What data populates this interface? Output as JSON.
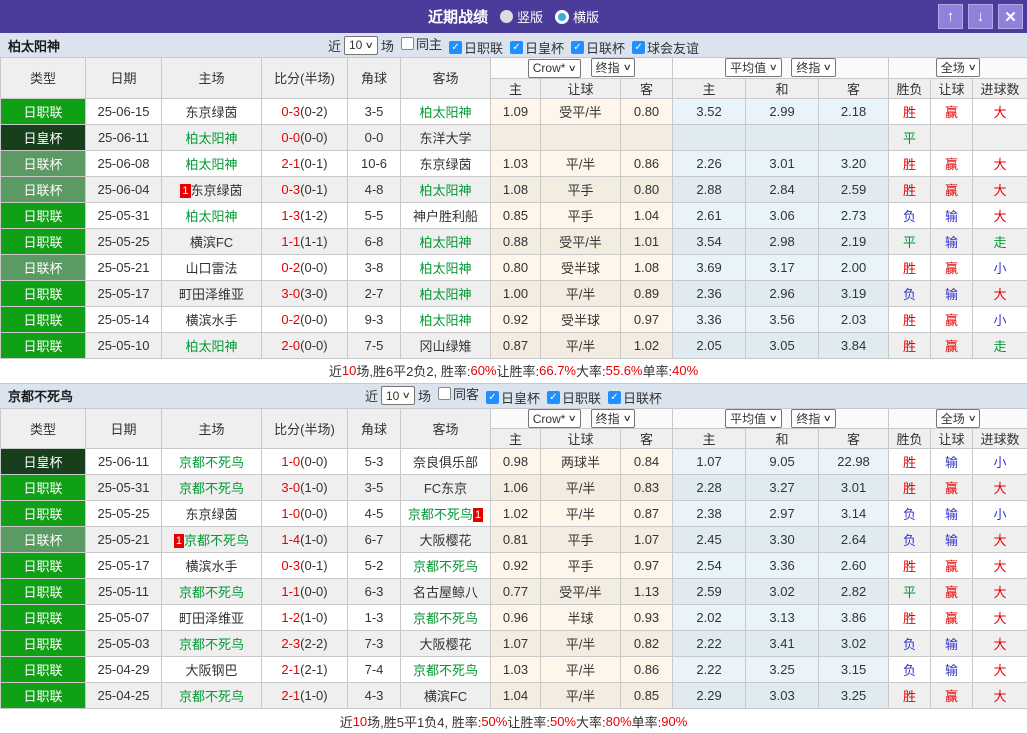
{
  "titlebar": {
    "title": "近期战绩",
    "options": [
      {
        "label": "竖版",
        "selected": false
      },
      {
        "label": "横版",
        "selected": true
      }
    ],
    "icons": {
      "up": "↑",
      "down": "↓",
      "close": "✕"
    }
  },
  "colors": {
    "accent_purple": "#4B3C9C",
    "league_jleague_green": "#0FA015",
    "league_emperor_cup_dark": "#173F1C",
    "league_league_cup_sage": "#5C9A64",
    "self_team_green": "#009933",
    "score_red": "#E60000",
    "result_blue": "#3333CC",
    "checkbox_blue": "#1E90FF"
  },
  "columns": {
    "type": "类型",
    "date": "日期",
    "home": "主场",
    "score": "比分(半场)",
    "corner": "角球",
    "away": "客场",
    "dd_crow": "Crow*",
    "dd_final1": "终指",
    "dd_avg": "平均值",
    "dd_final2": "终指",
    "dd_full": "全场",
    "g1_home": "主",
    "g1_handicap": "让球",
    "g1_away": "客",
    "g2_home": "主",
    "g2_draw": "和",
    "g2_away": "客",
    "res_wl": "胜负",
    "res_handicap": "让球",
    "res_goals": "进球数"
  },
  "sections": [
    {
      "team": "柏太阳神",
      "filter": {
        "near": "近",
        "count": "10",
        "games": "场",
        "checkboxes": [
          {
            "label": "同主",
            "checked": false
          },
          {
            "label": "日职联",
            "checked": true
          },
          {
            "label": "日皇杯",
            "checked": true
          },
          {
            "label": "日联杯",
            "checked": true
          },
          {
            "label": "球会友谊",
            "checked": true
          }
        ]
      },
      "rows": [
        {
          "type": "日职联",
          "tc": "green",
          "date": "25-06-15",
          "home": "东京绿茵",
          "hself": false,
          "hb": "",
          "hbp": "",
          "ft": "0-3",
          "ht": "(0-2)",
          "corner": "3-5",
          "away": "柏太阳神",
          "aself": true,
          "ab": "",
          "abp": "",
          "odds": [
            "1.09",
            "受平/半",
            "0.80",
            "3.52",
            "2.99",
            "2.18"
          ],
          "res": [
            [
              "胜",
              "r"
            ],
            [
              "赢",
              "r"
            ],
            [
              "大",
              "r"
            ]
          ]
        },
        {
          "type": "日皇杯",
          "tc": "dark",
          "date": "25-06-11",
          "home": "柏太阳神",
          "hself": true,
          "hb": "",
          "hbp": "",
          "ft": "0-0",
          "ht": "(0-0)",
          "corner": "0-0",
          "away": "东洋大学",
          "aself": false,
          "ab": "",
          "abp": "",
          "odds": [
            "",
            "",
            "",
            "",
            "",
            ""
          ],
          "res": [
            [
              "平",
              "g"
            ],
            [
              "",
              ""
            ],
            [
              "",
              ""
            ]
          ]
        },
        {
          "type": "日联杯",
          "tc": "sage",
          "date": "25-06-08",
          "home": "柏太阳神",
          "hself": true,
          "hb": "",
          "hbp": "",
          "ft": "2-1",
          "ht": "(0-1)",
          "corner": "10-6",
          "away": "东京绿茵",
          "aself": false,
          "ab": "",
          "abp": "",
          "odds": [
            "1.03",
            "平/半",
            "0.86",
            "2.26",
            "3.01",
            "3.20"
          ],
          "res": [
            [
              "胜",
              "r"
            ],
            [
              "赢",
              "r"
            ],
            [
              "大",
              "r"
            ]
          ]
        },
        {
          "type": "日联杯",
          "tc": "sage",
          "date": "25-06-04",
          "home": "东京绿茵",
          "hself": false,
          "hb": "1",
          "hbp": "before",
          "ft": "0-3",
          "ht": "(0-1)",
          "corner": "4-8",
          "away": "柏太阳神",
          "aself": true,
          "ab": "",
          "abp": "",
          "odds": [
            "1.08",
            "平手",
            "0.80",
            "2.88",
            "2.84",
            "2.59"
          ],
          "res": [
            [
              "胜",
              "r"
            ],
            [
              "赢",
              "r"
            ],
            [
              "大",
              "r"
            ]
          ]
        },
        {
          "type": "日职联",
          "tc": "green",
          "date": "25-05-31",
          "home": "柏太阳神",
          "hself": true,
          "hb": "",
          "hbp": "",
          "ft": "1-3",
          "ht": "(1-2)",
          "corner": "5-5",
          "away": "神户胜利船",
          "aself": false,
          "ab": "",
          "abp": "",
          "odds": [
            "0.85",
            "平手",
            "1.04",
            "2.61",
            "3.06",
            "2.73"
          ],
          "res": [
            [
              "负",
              "b"
            ],
            [
              "输",
              "b"
            ],
            [
              "大",
              "r"
            ]
          ]
        },
        {
          "type": "日职联",
          "tc": "green",
          "date": "25-05-25",
          "home": "横滨FC",
          "hself": false,
          "hb": "",
          "hbp": "",
          "ft": "1-1",
          "ht": "(1-1)",
          "corner": "6-8",
          "away": "柏太阳神",
          "aself": true,
          "ab": "",
          "abp": "",
          "odds": [
            "0.88",
            "受平/半",
            "1.01",
            "3.54",
            "2.98",
            "2.19"
          ],
          "res": [
            [
              "平",
              "g"
            ],
            [
              "输",
              "b"
            ],
            [
              "走",
              "g"
            ]
          ]
        },
        {
          "type": "日联杯",
          "tc": "sage",
          "date": "25-05-21",
          "home": "山口雷法",
          "hself": false,
          "hb": "",
          "hbp": "",
          "ft": "0-2",
          "ht": "(0-0)",
          "corner": "3-8",
          "away": "柏太阳神",
          "aself": true,
          "ab": "",
          "abp": "",
          "odds": [
            "0.80",
            "受半球",
            "1.08",
            "3.69",
            "3.17",
            "2.00"
          ],
          "res": [
            [
              "胜",
              "r"
            ],
            [
              "赢",
              "r"
            ],
            [
              "小",
              "b"
            ]
          ]
        },
        {
          "type": "日职联",
          "tc": "green",
          "date": "25-05-17",
          "home": "町田泽维亚",
          "hself": false,
          "hb": "",
          "hbp": "",
          "ft": "3-0",
          "ht": "(3-0)",
          "corner": "2-7",
          "away": "柏太阳神",
          "aself": true,
          "ab": "",
          "abp": "",
          "odds": [
            "1.00",
            "平/半",
            "0.89",
            "2.36",
            "2.96",
            "3.19"
          ],
          "res": [
            [
              "负",
              "b"
            ],
            [
              "输",
              "b"
            ],
            [
              "大",
              "r"
            ]
          ]
        },
        {
          "type": "日职联",
          "tc": "green",
          "date": "25-05-14",
          "home": "横滨水手",
          "hself": false,
          "hb": "",
          "hbp": "",
          "ft": "0-2",
          "ht": "(0-0)",
          "corner": "9-3",
          "away": "柏太阳神",
          "aself": true,
          "ab": "",
          "abp": "",
          "odds": [
            "0.92",
            "受半球",
            "0.97",
            "3.36",
            "3.56",
            "2.03"
          ],
          "res": [
            [
              "胜",
              "r"
            ],
            [
              "赢",
              "r"
            ],
            [
              "小",
              "b"
            ]
          ]
        },
        {
          "type": "日职联",
          "tc": "green",
          "date": "25-05-10",
          "home": "柏太阳神",
          "hself": true,
          "hb": "",
          "hbp": "",
          "ft": "2-0",
          "ht": "(0-0)",
          "corner": "7-5",
          "away": "冈山绿雉",
          "aself": false,
          "ab": "",
          "abp": "",
          "odds": [
            "0.87",
            "平/半",
            "1.02",
            "2.05",
            "3.05",
            "3.84"
          ],
          "res": [
            [
              "胜",
              "r"
            ],
            [
              "赢",
              "r"
            ],
            [
              "走",
              "g"
            ]
          ]
        }
      ],
      "summary": [
        [
          "近",
          "k"
        ],
        [
          "10",
          "r"
        ],
        [
          "场,胜6平2负2, 胜率:",
          "k"
        ],
        [
          "60%",
          "r"
        ],
        [
          " 让胜率:",
          "k"
        ],
        [
          "66.7%",
          "r"
        ],
        [
          " 大率:",
          "k"
        ],
        [
          "55.6%",
          "r"
        ],
        [
          " 单率:",
          "k"
        ],
        [
          "40%",
          "r"
        ]
      ]
    },
    {
      "team": "京都不死鸟",
      "filter": {
        "near": "近",
        "count": "10",
        "games": "场",
        "checkboxes": [
          {
            "label": "同客",
            "checked": false
          },
          {
            "label": "日皇杯",
            "checked": true
          },
          {
            "label": "日职联",
            "checked": true
          },
          {
            "label": "日联杯",
            "checked": true
          }
        ]
      },
      "rows": [
        {
          "type": "日皇杯",
          "tc": "dark",
          "date": "25-06-11",
          "home": "京都不死鸟",
          "hself": true,
          "hb": "",
          "hbp": "",
          "ft": "1-0",
          "ht": "(0-0)",
          "corner": "5-3",
          "away": "奈良俱乐部",
          "aself": false,
          "ab": "",
          "abp": "",
          "odds": [
            "0.98",
            "两球半",
            "0.84",
            "1.07",
            "9.05",
            "22.98"
          ],
          "res": [
            [
              "胜",
              "r"
            ],
            [
              "输",
              "b"
            ],
            [
              "小",
              "b"
            ]
          ]
        },
        {
          "type": "日职联",
          "tc": "green",
          "date": "25-05-31",
          "home": "京都不死鸟",
          "hself": true,
          "hb": "",
          "hbp": "",
          "ft": "3-0",
          "ht": "(1-0)",
          "corner": "3-5",
          "away": "FC东京",
          "aself": false,
          "ab": "",
          "abp": "",
          "odds": [
            "1.06",
            "平/半",
            "0.83",
            "2.28",
            "3.27",
            "3.01"
          ],
          "res": [
            [
              "胜",
              "r"
            ],
            [
              "赢",
              "r"
            ],
            [
              "大",
              "r"
            ]
          ]
        },
        {
          "type": "日职联",
          "tc": "green",
          "date": "25-05-25",
          "home": "东京绿茵",
          "hself": false,
          "hb": "",
          "hbp": "",
          "ft": "1-0",
          "ht": "(0-0)",
          "corner": "4-5",
          "away": "京都不死鸟",
          "aself": true,
          "ab": "1",
          "abp": "after",
          "odds": [
            "1.02",
            "平/半",
            "0.87",
            "2.38",
            "2.97",
            "3.14"
          ],
          "res": [
            [
              "负",
              "b"
            ],
            [
              "输",
              "b"
            ],
            [
              "小",
              "b"
            ]
          ]
        },
        {
          "type": "日联杯",
          "tc": "sage",
          "date": "25-05-21",
          "home": "京都不死鸟",
          "hself": true,
          "hb": "1",
          "hbp": "before",
          "ft": "1-4",
          "ht": "(1-0)",
          "corner": "6-7",
          "away": "大阪樱花",
          "aself": false,
          "ab": "",
          "abp": "",
          "odds": [
            "0.81",
            "平手",
            "1.07",
            "2.45",
            "3.30",
            "2.64"
          ],
          "res": [
            [
              "负",
              "b"
            ],
            [
              "输",
              "b"
            ],
            [
              "大",
              "r"
            ]
          ]
        },
        {
          "type": "日职联",
          "tc": "green",
          "date": "25-05-17",
          "home": "横滨水手",
          "hself": false,
          "hb": "",
          "hbp": "",
          "ft": "0-3",
          "ht": "(0-1)",
          "corner": "5-2",
          "away": "京都不死鸟",
          "aself": true,
          "ab": "",
          "abp": "",
          "odds": [
            "0.92",
            "平手",
            "0.97",
            "2.54",
            "3.36",
            "2.60"
          ],
          "res": [
            [
              "胜",
              "r"
            ],
            [
              "赢",
              "r"
            ],
            [
              "大",
              "r"
            ]
          ]
        },
        {
          "type": "日职联",
          "tc": "green",
          "date": "25-05-11",
          "home": "京都不死鸟",
          "hself": true,
          "hb": "",
          "hbp": "",
          "ft": "1-1",
          "ht": "(0-0)",
          "corner": "6-3",
          "away": "名古屋鲸八",
          "aself": false,
          "ab": "",
          "abp": "",
          "odds": [
            "0.77",
            "受平/半",
            "1.13",
            "2.59",
            "3.02",
            "2.82"
          ],
          "res": [
            [
              "平",
              "g"
            ],
            [
              "赢",
              "r"
            ],
            [
              "大",
              "r"
            ]
          ]
        },
        {
          "type": "日职联",
          "tc": "green",
          "date": "25-05-07",
          "home": "町田泽维亚",
          "hself": false,
          "hb": "",
          "hbp": "",
          "ft": "1-2",
          "ht": "(1-0)",
          "corner": "1-3",
          "away": "京都不死鸟",
          "aself": true,
          "ab": "",
          "abp": "",
          "odds": [
            "0.96",
            "半球",
            "0.93",
            "2.02",
            "3.13",
            "3.86"
          ],
          "res": [
            [
              "胜",
              "r"
            ],
            [
              "赢",
              "r"
            ],
            [
              "大",
              "r"
            ]
          ]
        },
        {
          "type": "日职联",
          "tc": "green",
          "date": "25-05-03",
          "home": "京都不死鸟",
          "hself": true,
          "hb": "",
          "hbp": "",
          "ft": "2-3",
          "ht": "(2-2)",
          "corner": "7-3",
          "away": "大阪樱花",
          "aself": false,
          "ab": "",
          "abp": "",
          "odds": [
            "1.07",
            "平/半",
            "0.82",
            "2.22",
            "3.41",
            "3.02"
          ],
          "res": [
            [
              "负",
              "b"
            ],
            [
              "输",
              "b"
            ],
            [
              "大",
              "r"
            ]
          ]
        },
        {
          "type": "日职联",
          "tc": "green",
          "date": "25-04-29",
          "home": "大阪钢巴",
          "hself": false,
          "hb": "",
          "hbp": "",
          "ft": "2-1",
          "ht": "(2-1)",
          "corner": "7-4",
          "away": "京都不死鸟",
          "aself": true,
          "ab": "",
          "abp": "",
          "odds": [
            "1.03",
            "平/半",
            "0.86",
            "2.22",
            "3.25",
            "3.15"
          ],
          "res": [
            [
              "负",
              "b"
            ],
            [
              "输",
              "b"
            ],
            [
              "大",
              "r"
            ]
          ]
        },
        {
          "type": "日职联",
          "tc": "green",
          "date": "25-04-25",
          "home": "京都不死鸟",
          "hself": true,
          "hb": "",
          "hbp": "",
          "ft": "2-1",
          "ht": "(1-0)",
          "corner": "4-3",
          "away": "横滨FC",
          "aself": false,
          "ab": "",
          "abp": "",
          "odds": [
            "1.04",
            "平/半",
            "0.85",
            "2.29",
            "3.03",
            "3.25"
          ],
          "res": [
            [
              "胜",
              "r"
            ],
            [
              "赢",
              "r"
            ],
            [
              "大",
              "r"
            ]
          ]
        }
      ],
      "summary": [
        [
          "近",
          "k"
        ],
        [
          "10",
          "r"
        ],
        [
          "场,胜5平1负4, 胜率:",
          "k"
        ],
        [
          "50%",
          "r"
        ],
        [
          " 让胜率:",
          "k"
        ],
        [
          "50%",
          "r"
        ],
        [
          " 大率:",
          "k"
        ],
        [
          "80%",
          "r"
        ],
        [
          " 单率:",
          "k"
        ],
        [
          "90%",
          "r"
        ]
      ]
    }
  ]
}
